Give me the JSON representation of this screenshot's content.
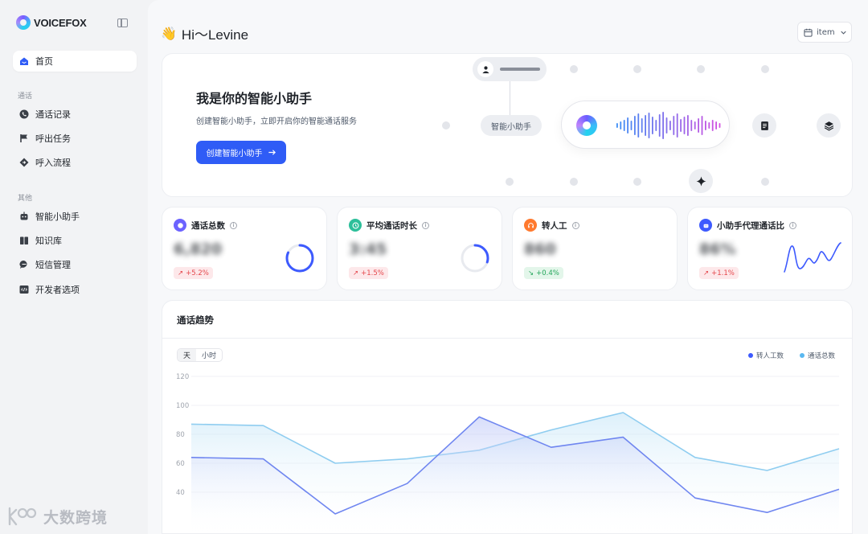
{
  "app": {
    "brand": "VOICEFOX"
  },
  "sidebar": {
    "top_items": [
      {
        "label": "首页",
        "icon": "home-icon",
        "active": true
      }
    ],
    "section_call": "通话",
    "call_items": [
      {
        "label": "通话记录",
        "icon": "phone-record-icon"
      },
      {
        "label": "呼出任务",
        "icon": "flag-icon"
      },
      {
        "label": "呼入流程",
        "icon": "flow-icon"
      }
    ],
    "section_other": "其他",
    "other_items": [
      {
        "label": "智能小助手",
        "icon": "robot-icon"
      },
      {
        "label": "知识库",
        "icon": "book-icon"
      },
      {
        "label": "短信管理",
        "icon": "message-icon"
      },
      {
        "label": "开发者选项",
        "icon": "code-icon"
      }
    ]
  },
  "header": {
    "greeting_emoji": "👋",
    "greeting": "Hi～Levine",
    "date_select": "item"
  },
  "hero": {
    "title": "我是你的智能小助手",
    "subtitle": "创建智能小助手，立即开启你的智能通话服务",
    "button": "创建智能小助手",
    "assistant_pill": "智能小助手"
  },
  "stats": [
    {
      "title": "通话总数",
      "value": "6,820",
      "change": "+5.2%",
      "trend": "up",
      "icon_color": "#6c63ff",
      "ring_fraction": 0.82
    },
    {
      "title": "平均通话时长",
      "value": "3:45",
      "change": "+1.5%",
      "trend": "up",
      "icon_color": "#2dbf9a",
      "ring_fraction": 0.3
    },
    {
      "title": "转人工",
      "value": "860",
      "change": "+0.4%",
      "trend": "down",
      "icon_color": "#ff7a2f"
    },
    {
      "title": "小助手代理通话比",
      "value": "86%",
      "change": "+1.1%",
      "trend": "up",
      "icon_color": "#3d5afe"
    }
  ],
  "trend": {
    "title": "通话趋势",
    "seg_day": "天",
    "seg_hour": "小时",
    "legend_human": "转人工数",
    "legend_total": "通话总数"
  },
  "chart_data": {
    "type": "line",
    "ylim": [
      0,
      120
    ],
    "yticks": [
      "120",
      "100",
      "80",
      "60",
      "40"
    ],
    "series": [
      {
        "name": "转人工数",
        "color": "#6f86f0",
        "values": [
          64,
          63,
          25,
          46,
          92,
          71,
          78,
          36,
          26,
          42
        ]
      },
      {
        "name": "通话总数",
        "color": "#8fcdf0",
        "values": [
          87,
          86,
          60,
          63,
          69,
          83,
          95,
          64,
          55,
          70
        ]
      }
    ]
  },
  "watermark": {
    "text": "大数跨境"
  }
}
